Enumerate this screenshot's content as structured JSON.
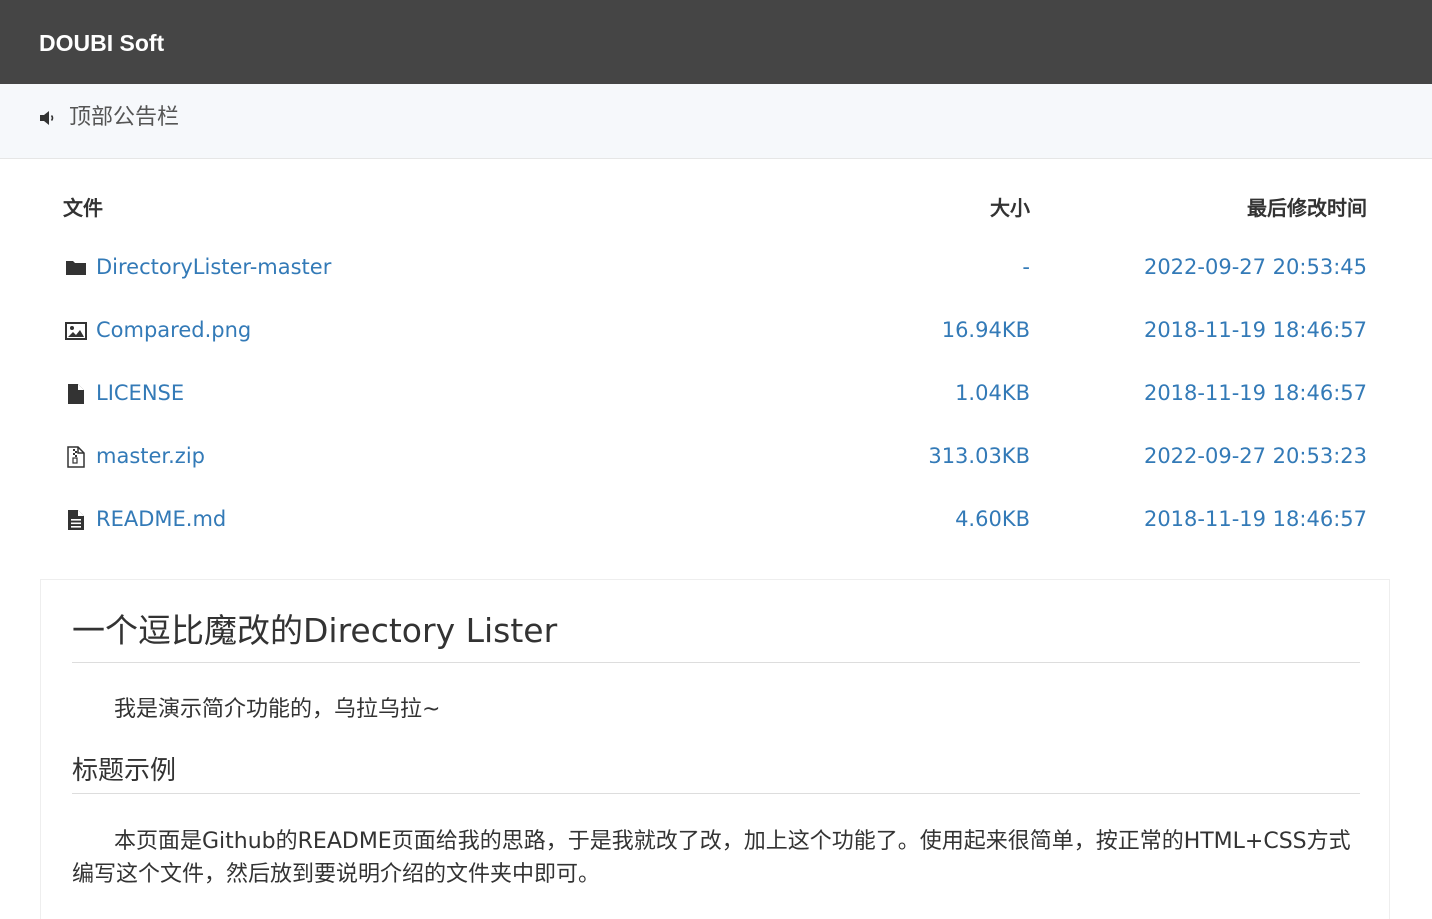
{
  "navbar": {
    "brand": "DOUBI Soft"
  },
  "notice": {
    "icon": "speaker-icon",
    "text": "顶部公告栏"
  },
  "file_table": {
    "headers": {
      "name": "文件",
      "size": "大小",
      "modified": "最后修改时间"
    },
    "rows": [
      {
        "icon": "folder-icon",
        "name": "DirectoryLister-master",
        "size": "-",
        "modified": "2022-09-27 20:53:45"
      },
      {
        "icon": "image-file-icon",
        "name": "Compared.png",
        "size": "16.94KB",
        "modified": "2018-11-19 18:46:57"
      },
      {
        "icon": "file-icon",
        "name": "LICENSE",
        "size": "1.04KB",
        "modified": "2018-11-19 18:46:57"
      },
      {
        "icon": "zip-file-icon",
        "name": "master.zip",
        "size": "313.03KB",
        "modified": "2022-09-27 20:53:23"
      },
      {
        "icon": "text-file-icon",
        "name": "README.md",
        "size": "4.60KB",
        "modified": "2018-11-19 18:46:57"
      }
    ]
  },
  "readme": {
    "title": "一个逗比魔改的Directory Lister",
    "intro": "我是演示简介功能的，乌拉乌拉~",
    "heading": "标题示例",
    "body": "本页面是Github的README页面给我的思路，于是我就改了改，加上这个功能了。使用起来很简单，按正常的HTML+CSS方式编写这个文件，然后放到要说明介绍的文件夹中即可。"
  },
  "colors": {
    "navbar_bg": "#454545",
    "notice_bg": "#f6f8fb",
    "link": "#337ab7",
    "text": "#333333"
  }
}
